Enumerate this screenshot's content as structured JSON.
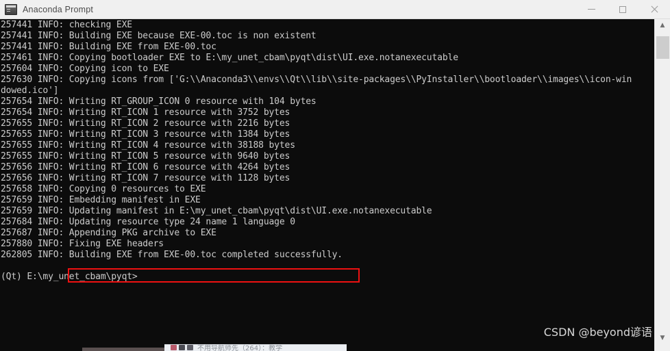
{
  "window": {
    "title": "Anaconda Prompt",
    "icon": "console-icon",
    "controls": {
      "minimize": "minimize-button",
      "maximize": "maximize-button",
      "close": "close-button"
    }
  },
  "console": {
    "lines": [
      "257441 INFO: checking EXE",
      "257441 INFO: Building EXE because EXE-00.toc is non existent",
      "257441 INFO: Building EXE from EXE-00.toc",
      "257461 INFO: Copying bootloader EXE to E:\\my_unet_cbam\\pyqt\\dist\\UI.exe.notanexecutable",
      "257604 INFO: Copying icon to EXE",
      "257630 INFO: Copying icons from ['G:\\\\Anaconda3\\\\envs\\\\Qt\\\\lib\\\\site-packages\\\\PyInstaller\\\\bootloader\\\\images\\\\icon-win",
      "dowed.ico']",
      "257654 INFO: Writing RT_GROUP_ICON 0 resource with 104 bytes",
      "257654 INFO: Writing RT_ICON 1 resource with 3752 bytes",
      "257655 INFO: Writing RT_ICON 2 resource with 2216 bytes",
      "257655 INFO: Writing RT_ICON 3 resource with 1384 bytes",
      "257655 INFO: Writing RT_ICON 4 resource with 38188 bytes",
      "257655 INFO: Writing RT_ICON 5 resource with 9640 bytes",
      "257656 INFO: Writing RT_ICON 6 resource with 4264 bytes",
      "257656 INFO: Writing RT_ICON 7 resource with 1128 bytes",
      "257658 INFO: Copying 0 resources to EXE",
      "257659 INFO: Embedding manifest in EXE",
      "257659 INFO: Updating manifest in E:\\my_unet_cbam\\pyqt\\dist\\UI.exe.notanexecutable",
      "257684 INFO: Updating resource type 24 name 1 language 0",
      "257687 INFO: Appending PKG archive to EXE",
      "257880 INFO: Fixing EXE headers",
      "262805 INFO: Building EXE from EXE-00.toc completed successfully.",
      "",
      "(Qt) E:\\my_unet_cbam\\pyqt>"
    ],
    "highlighted_text": "Building EXE from EXE-00.toc completed successfully.",
    "highlight_color": "#ee1111",
    "prompt": "(Qt) E:\\my_unet_cbam\\pyqt>",
    "background_color": "#0c0c0c",
    "text_color": "#cccccc"
  },
  "scrollbar": {
    "up_arrow": "▲",
    "down_arrow": "▼"
  },
  "watermark": {
    "text": "CSDN @beyond谚语"
  },
  "background_window": {
    "label": "不用导航师先（264）：教学"
  }
}
